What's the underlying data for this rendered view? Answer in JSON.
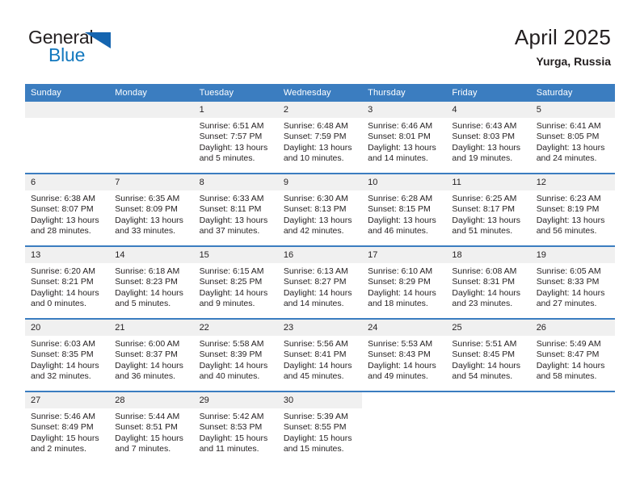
{
  "brand": {
    "name_part1": "General",
    "name_part2": "Blue",
    "triangle_icon": "triangle-icon",
    "accent_color": "#1278be",
    "header_color": "#3b7dc0"
  },
  "header": {
    "title": "April 2025",
    "location": "Yurga, Russia"
  },
  "weekdays": [
    "Sunday",
    "Monday",
    "Tuesday",
    "Wednesday",
    "Thursday",
    "Friday",
    "Saturday"
  ],
  "labels": {
    "sunrise_prefix": "Sunrise:",
    "sunset_prefix": "Sunset:",
    "daylight_prefix": "Daylight:"
  },
  "weeks": [
    [
      {
        "day": "",
        "sunrise": "",
        "sunset": "",
        "daylight_line1": "",
        "daylight_line2": "",
        "empty": true
      },
      {
        "day": "",
        "sunrise": "",
        "sunset": "",
        "daylight_line1": "",
        "daylight_line2": "",
        "empty": true
      },
      {
        "day": "1",
        "sunrise": "Sunrise: 6:51 AM",
        "sunset": "Sunset: 7:57 PM",
        "daylight_line1": "Daylight: 13 hours",
        "daylight_line2": "and 5 minutes."
      },
      {
        "day": "2",
        "sunrise": "Sunrise: 6:48 AM",
        "sunset": "Sunset: 7:59 PM",
        "daylight_line1": "Daylight: 13 hours",
        "daylight_line2": "and 10 minutes."
      },
      {
        "day": "3",
        "sunrise": "Sunrise: 6:46 AM",
        "sunset": "Sunset: 8:01 PM",
        "daylight_line1": "Daylight: 13 hours",
        "daylight_line2": "and 14 minutes."
      },
      {
        "day": "4",
        "sunrise": "Sunrise: 6:43 AM",
        "sunset": "Sunset: 8:03 PM",
        "daylight_line1": "Daylight: 13 hours",
        "daylight_line2": "and 19 minutes."
      },
      {
        "day": "5",
        "sunrise": "Sunrise: 6:41 AM",
        "sunset": "Sunset: 8:05 PM",
        "daylight_line1": "Daylight: 13 hours",
        "daylight_line2": "and 24 minutes."
      }
    ],
    [
      {
        "day": "6",
        "sunrise": "Sunrise: 6:38 AM",
        "sunset": "Sunset: 8:07 PM",
        "daylight_line1": "Daylight: 13 hours",
        "daylight_line2": "and 28 minutes."
      },
      {
        "day": "7",
        "sunrise": "Sunrise: 6:35 AM",
        "sunset": "Sunset: 8:09 PM",
        "daylight_line1": "Daylight: 13 hours",
        "daylight_line2": "and 33 minutes."
      },
      {
        "day": "8",
        "sunrise": "Sunrise: 6:33 AM",
        "sunset": "Sunset: 8:11 PM",
        "daylight_line1": "Daylight: 13 hours",
        "daylight_line2": "and 37 minutes."
      },
      {
        "day": "9",
        "sunrise": "Sunrise: 6:30 AM",
        "sunset": "Sunset: 8:13 PM",
        "daylight_line1": "Daylight: 13 hours",
        "daylight_line2": "and 42 minutes."
      },
      {
        "day": "10",
        "sunrise": "Sunrise: 6:28 AM",
        "sunset": "Sunset: 8:15 PM",
        "daylight_line1": "Daylight: 13 hours",
        "daylight_line2": "and 46 minutes."
      },
      {
        "day": "11",
        "sunrise": "Sunrise: 6:25 AM",
        "sunset": "Sunset: 8:17 PM",
        "daylight_line1": "Daylight: 13 hours",
        "daylight_line2": "and 51 minutes."
      },
      {
        "day": "12",
        "sunrise": "Sunrise: 6:23 AM",
        "sunset": "Sunset: 8:19 PM",
        "daylight_line1": "Daylight: 13 hours",
        "daylight_line2": "and 56 minutes."
      }
    ],
    [
      {
        "day": "13",
        "sunrise": "Sunrise: 6:20 AM",
        "sunset": "Sunset: 8:21 PM",
        "daylight_line1": "Daylight: 14 hours",
        "daylight_line2": "and 0 minutes."
      },
      {
        "day": "14",
        "sunrise": "Sunrise: 6:18 AM",
        "sunset": "Sunset: 8:23 PM",
        "daylight_line1": "Daylight: 14 hours",
        "daylight_line2": "and 5 minutes."
      },
      {
        "day": "15",
        "sunrise": "Sunrise: 6:15 AM",
        "sunset": "Sunset: 8:25 PM",
        "daylight_line1": "Daylight: 14 hours",
        "daylight_line2": "and 9 minutes."
      },
      {
        "day": "16",
        "sunrise": "Sunrise: 6:13 AM",
        "sunset": "Sunset: 8:27 PM",
        "daylight_line1": "Daylight: 14 hours",
        "daylight_line2": "and 14 minutes."
      },
      {
        "day": "17",
        "sunrise": "Sunrise: 6:10 AM",
        "sunset": "Sunset: 8:29 PM",
        "daylight_line1": "Daylight: 14 hours",
        "daylight_line2": "and 18 minutes."
      },
      {
        "day": "18",
        "sunrise": "Sunrise: 6:08 AM",
        "sunset": "Sunset: 8:31 PM",
        "daylight_line1": "Daylight: 14 hours",
        "daylight_line2": "and 23 minutes."
      },
      {
        "day": "19",
        "sunrise": "Sunrise: 6:05 AM",
        "sunset": "Sunset: 8:33 PM",
        "daylight_line1": "Daylight: 14 hours",
        "daylight_line2": "and 27 minutes."
      }
    ],
    [
      {
        "day": "20",
        "sunrise": "Sunrise: 6:03 AM",
        "sunset": "Sunset: 8:35 PM",
        "daylight_line1": "Daylight: 14 hours",
        "daylight_line2": "and 32 minutes."
      },
      {
        "day": "21",
        "sunrise": "Sunrise: 6:00 AM",
        "sunset": "Sunset: 8:37 PM",
        "daylight_line1": "Daylight: 14 hours",
        "daylight_line2": "and 36 minutes."
      },
      {
        "day": "22",
        "sunrise": "Sunrise: 5:58 AM",
        "sunset": "Sunset: 8:39 PM",
        "daylight_line1": "Daylight: 14 hours",
        "daylight_line2": "and 40 minutes."
      },
      {
        "day": "23",
        "sunrise": "Sunrise: 5:56 AM",
        "sunset": "Sunset: 8:41 PM",
        "daylight_line1": "Daylight: 14 hours",
        "daylight_line2": "and 45 minutes."
      },
      {
        "day": "24",
        "sunrise": "Sunrise: 5:53 AM",
        "sunset": "Sunset: 8:43 PM",
        "daylight_line1": "Daylight: 14 hours",
        "daylight_line2": "and 49 minutes."
      },
      {
        "day": "25",
        "sunrise": "Sunrise: 5:51 AM",
        "sunset": "Sunset: 8:45 PM",
        "daylight_line1": "Daylight: 14 hours",
        "daylight_line2": "and 54 minutes."
      },
      {
        "day": "26",
        "sunrise": "Sunrise: 5:49 AM",
        "sunset": "Sunset: 8:47 PM",
        "daylight_line1": "Daylight: 14 hours",
        "daylight_line2": "and 58 minutes."
      }
    ],
    [
      {
        "day": "27",
        "sunrise": "Sunrise: 5:46 AM",
        "sunset": "Sunset: 8:49 PM",
        "daylight_line1": "Daylight: 15 hours",
        "daylight_line2": "and 2 minutes."
      },
      {
        "day": "28",
        "sunrise": "Sunrise: 5:44 AM",
        "sunset": "Sunset: 8:51 PM",
        "daylight_line1": "Daylight: 15 hours",
        "daylight_line2": "and 7 minutes."
      },
      {
        "day": "29",
        "sunrise": "Sunrise: 5:42 AM",
        "sunset": "Sunset: 8:53 PM",
        "daylight_line1": "Daylight: 15 hours",
        "daylight_line2": "and 11 minutes."
      },
      {
        "day": "30",
        "sunrise": "Sunrise: 5:39 AM",
        "sunset": "Sunset: 8:55 PM",
        "daylight_line1": "Daylight: 15 hours",
        "daylight_line2": "and 15 minutes."
      },
      {
        "day": "",
        "sunrise": "",
        "sunset": "",
        "daylight_line1": "",
        "daylight_line2": "",
        "blank": true
      },
      {
        "day": "",
        "sunrise": "",
        "sunset": "",
        "daylight_line1": "",
        "daylight_line2": "",
        "blank": true
      },
      {
        "day": "",
        "sunrise": "",
        "sunset": "",
        "daylight_line1": "",
        "daylight_line2": "",
        "blank": true
      }
    ]
  ]
}
